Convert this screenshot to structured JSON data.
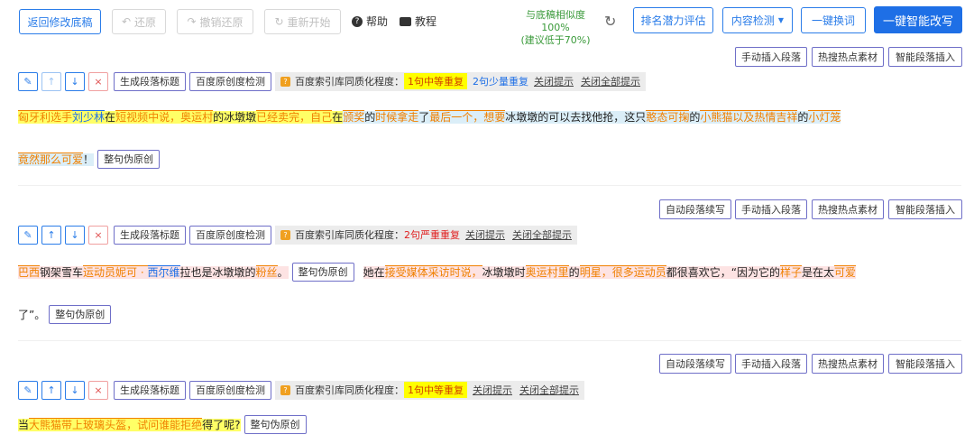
{
  "toolbar": {
    "back": "返回修改底稿",
    "undo": "还原",
    "redo": "撤销还原",
    "restart": "重新开始",
    "help": "帮助",
    "tutorial": "教程",
    "similarity_line1": "与底稿相似度 100%",
    "similarity_line2": "(建议低于70%)",
    "rank": "排名潜力评估",
    "content_check": "内容检测",
    "replace_words": "一键换词",
    "smart_rewrite": "一键智能改写"
  },
  "para_actions": {
    "auto_continue": "自动段落续写",
    "manual_insert": "手动插入段落",
    "hot_material": "热搜热点素材",
    "smart_insert": "智能段落插入"
  },
  "block_tools": {
    "gen_title": "生成段落标题",
    "baidu_check": "百度原创度检测",
    "dup_label": "百度索引库同质化程度：",
    "close_tip": "关闭提示",
    "close_all": "关闭全部提示",
    "fake_original": "整句伪原创"
  },
  "blocks": [
    {
      "dup1": "1句中等重复",
      "dup2": "2句少量重复",
      "line1": [
        {
          "t": "匈牙利",
          "c": "o",
          "h": "y"
        },
        {
          "t": "选手",
          "c": "o",
          "h": "y"
        },
        {
          "t": "刘少林",
          "c": "b",
          "h": "y"
        },
        {
          "t": "在",
          "c": "k",
          "h": "y"
        },
        {
          "t": "短视频",
          "c": "o",
          "h": "y"
        },
        {
          "t": "中说，",
          "c": "o",
          "h": "y"
        },
        {
          "t": "奥运村",
          "c": "o",
          "h": "y"
        },
        {
          "t": "的冰墩墩",
          "c": "k",
          "h": "y"
        },
        {
          "t": "已经",
          "c": "o",
          "h": "y"
        },
        {
          "t": "卖完，",
          "c": "o",
          "h": "y"
        },
        {
          "t": "自己",
          "c": "o",
          "h": "y"
        },
        {
          "t": "在",
          "c": "k",
          "h": "y"
        },
        {
          "t": "颁奖",
          "c": "o",
          "h": "b"
        },
        {
          "t": "的",
          "c": "k",
          "h": "b"
        },
        {
          "t": "时候",
          "c": "o",
          "h": "b"
        },
        {
          "t": "拿走",
          "c": "o",
          "h": "b"
        },
        {
          "t": "了",
          "c": "k",
          "h": "b"
        },
        {
          "t": "最后一个，",
          "c": "o",
          "h": "b"
        },
        {
          "t": "想要",
          "c": "o",
          "h": "b"
        },
        {
          "t": "冰墩墩的可以去找他抢，这只",
          "c": "k",
          "h": "b"
        },
        {
          "t": "憨态可掬",
          "c": "o",
          "h": "b"
        },
        {
          "t": "的",
          "c": "k",
          "h": "b"
        },
        {
          "t": "小熊猫",
          "c": "o",
          "h": "b"
        },
        {
          "t": "以及",
          "c": "o",
          "h": "b"
        },
        {
          "t": "热情",
          "c": "o",
          "h": "b"
        },
        {
          "t": "吉祥",
          "c": "o",
          "h": "b"
        },
        {
          "t": "的",
          "c": "k",
          "h": "b"
        },
        {
          "t": "小灯笼",
          "c": "o",
          "h": "b"
        }
      ],
      "line2": [
        {
          "t": "竟然",
          "c": "o",
          "h": "b"
        },
        {
          "t": "那么",
          "c": "o",
          "h": "b"
        },
        {
          "t": "可爱",
          "c": "o",
          "h": "b"
        },
        {
          "t": "！",
          "c": "k",
          "h": "b"
        }
      ]
    },
    {
      "dup1": "2句严重重复",
      "line1a": [
        {
          "t": "巴西",
          "c": "o",
          "h": "p"
        },
        {
          "t": "钢架雪车",
          "c": "k",
          "h": "p"
        },
        {
          "t": "运动员",
          "c": "o",
          "h": "p"
        },
        {
          "t": "妮可 · ",
          "c": "o",
          "h": "p"
        },
        {
          "t": "西尔维",
          "c": "b",
          "h": "p"
        },
        {
          "t": "拉也是冰墩墩的",
          "c": "k",
          "h": "p"
        },
        {
          "t": "粉丝",
          "c": "o",
          "h": "p"
        },
        {
          "t": "。",
          "c": "k",
          "h": "p"
        }
      ],
      "line1b": [
        {
          "t": "她在",
          "c": "k",
          "h": "p"
        },
        {
          "t": "接受",
          "c": "o",
          "h": "p"
        },
        {
          "t": "媒体",
          "c": "o",
          "h": "p"
        },
        {
          "t": "采访",
          "c": "o",
          "h": "p"
        },
        {
          "t": "时说，",
          "c": "o",
          "h": "p"
        },
        {
          "t": "冰墩墩时",
          "c": "k",
          "h": "p"
        },
        {
          "t": "奥运村里",
          "c": "o",
          "h": "p"
        },
        {
          "t": "的",
          "c": "k",
          "h": "p"
        },
        {
          "t": "明星，",
          "c": "o",
          "h": "p"
        },
        {
          "t": "很多",
          "c": "o",
          "h": "p"
        },
        {
          "t": "运动员",
          "c": "o",
          "h": "p"
        },
        {
          "t": "都很喜欢它，“因为它的",
          "c": "k",
          "h": "p"
        },
        {
          "t": "样子",
          "c": "o",
          "h": "p"
        },
        {
          "t": "是在太",
          "c": "k",
          "h": "p"
        },
        {
          "t": "可爱",
          "c": "o",
          "h": "p"
        }
      ],
      "line2": [
        {
          "t": "了”。",
          "c": "k",
          "h": ""
        }
      ]
    },
    {
      "dup1": "1句中等重复",
      "line1": [
        {
          "t": "当",
          "c": "k",
          "h": "y"
        },
        {
          "t": "大熊猫",
          "c": "o",
          "h": "y"
        },
        {
          "t": "带上",
          "c": "o",
          "h": "y"
        },
        {
          "t": "玻璃",
          "c": "o",
          "h": "y"
        },
        {
          "t": "头盔，",
          "c": "o",
          "h": "y"
        },
        {
          "t": "试问",
          "c": "o",
          "h": "y"
        },
        {
          "t": "谁能",
          "c": "o",
          "h": "y"
        },
        {
          "t": "拒绝",
          "c": "o",
          "h": "y"
        },
        {
          "t": "得了呢?",
          "c": "k",
          "h": "y"
        }
      ]
    }
  ],
  "icons": [
    "edit-icon",
    "arrow-up-icon",
    "arrow-down-icon",
    "close-icon",
    "undo-icon",
    "redo-icon",
    "refresh-icon",
    "help-icon",
    "video-icon",
    "caret-down-icon"
  ]
}
